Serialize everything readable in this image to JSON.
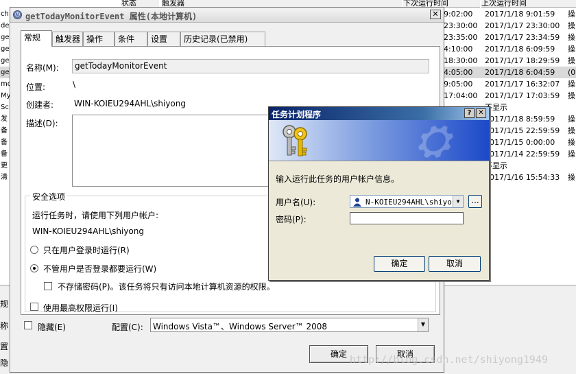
{
  "background": {
    "columns": {
      "status": "状态",
      "trigger": "触发器",
      "next_run": "下次运行时间",
      "last_run": "上次运行时间"
    },
    "rows": [
      {
        "name": "ch",
        "next": "9:02:00",
        "last": "2017/1/18 9:01:59",
        "result": "操"
      },
      {
        "name": "de",
        "next": "23:30:00",
        "last": "2017/1/17 23:30:00",
        "result": "操"
      },
      {
        "name": "ge",
        "next": "23:35:00",
        "last": "2017/1/17 23:34:59",
        "result": "操"
      },
      {
        "name": "ge",
        "next": "4:10:00",
        "last": "2017/1/18 6:09:59",
        "result": "操"
      },
      {
        "name": "ge",
        "next": "18:30:00",
        "last": "2017/1/17 18:29:59",
        "result": "操"
      },
      {
        "name": "ge",
        "next": "4:05:00",
        "last": "2017/1/18 6:04:59",
        "result": "(0"
      },
      {
        "name": "mo",
        "next": "9:05:00",
        "last": "2017/1/17 16:32:07",
        "result": "操"
      },
      {
        "name": "My",
        "next": "17:04:00",
        "last": "2017/1/17 17:03:59",
        "result": "操"
      },
      {
        "name": "Sc",
        "next": "",
        "last": "不显示",
        "result": ""
      },
      {
        "name": "发",
        "next": "",
        "last": "2017/1/18 8:59:59",
        "result": "操"
      },
      {
        "name": "备",
        "next": "",
        "last": "2017/1/15 22:59:59",
        "result": "操"
      },
      {
        "name": "备",
        "next": "",
        "last": "2017/1/15 0:00:00",
        "result": "操"
      },
      {
        "name": "备",
        "next": "",
        "last": "2017/1/14 22:59:59",
        "result": "操"
      },
      {
        "name": "更",
        "next": "",
        "last": "不显示",
        "result": ""
      },
      {
        "name": "清",
        "next": "",
        "last": "2017/1/16 15:54:33",
        "result": "操"
      }
    ],
    "bottom_labels": [
      "规",
      "称",
      "置",
      "隐"
    ]
  },
  "props": {
    "title": "getTodayMonitorEvent 属性(本地计算机)",
    "tabs": [
      "常规",
      "触发器",
      "操作",
      "条件",
      "设置",
      "历史记录(已禁用)"
    ],
    "name_label": "名称(M):",
    "name_value": "getTodayMonitorEvent",
    "location_label": "位置:",
    "location_value": "\\",
    "author_label": "创建者:",
    "author_value": "WIN-KOIEU294AHL\\shiyong",
    "description_label": "描述(D):",
    "description_value": "",
    "security_group": "安全选项",
    "run_as_label": "运行任务时，请使用下列用户帐户:",
    "run_as_user": "WIN-KOIEU294AHL\\shiyong",
    "radio_logged_on": "只在用户登录时运行(R)",
    "radio_whether": "不管用户是否登录都要运行(W)",
    "check_no_store": "不存储密码(P)。该任务将只有访问本地计算机资源的权限。",
    "check_highest": "使用最高权限运行(I)",
    "check_hidden": "隐藏(E)",
    "configure_label": "配置(C):",
    "configure_value": "Windows Vista™、Windows Server™ 2008",
    "ok": "确定",
    "cancel": "取消"
  },
  "cred": {
    "title": "任务计划程序",
    "help": "?",
    "prompt": "输入运行此任务的用户帐户信息。",
    "user_label": "用户名(U):",
    "user_value": "N-KOIEU294AHL\\shiyong",
    "browse": "...",
    "password_label": "密码(P):",
    "password_value": "",
    "ok": "确定",
    "cancel": "取消"
  },
  "watermark": "http://blog.csdn.net/shiyong1949",
  "colors": {
    "title_bar": "#0a246a",
    "banner_blue": "#1c49c9",
    "dialog_bg": "#f0f0f0"
  }
}
